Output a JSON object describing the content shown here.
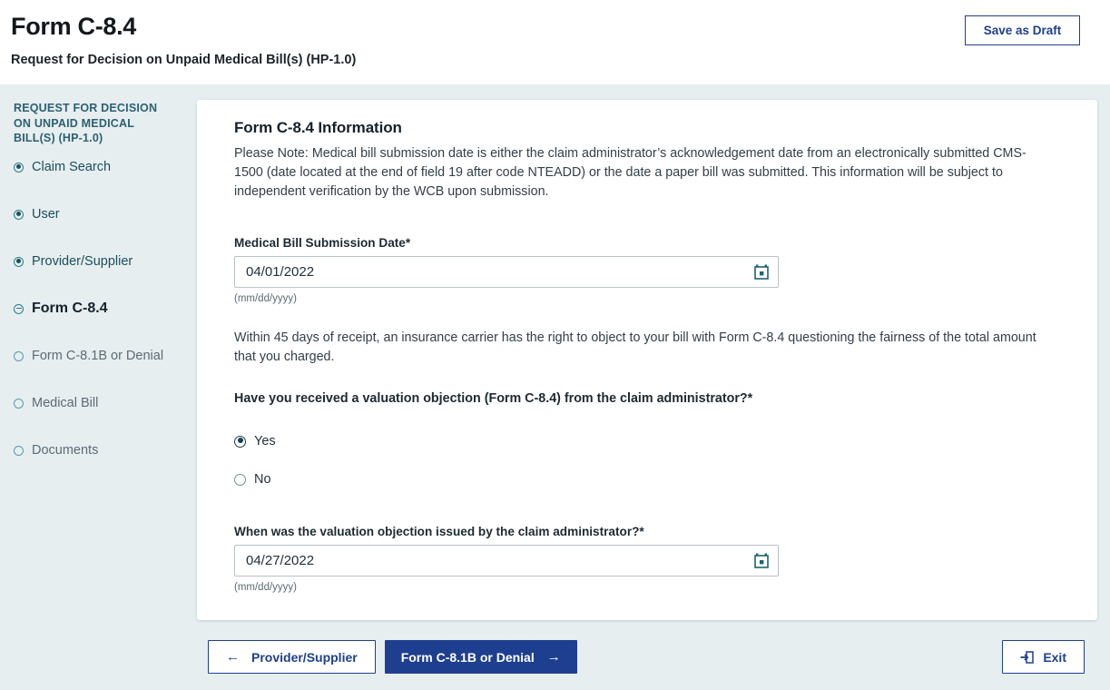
{
  "header": {
    "title": "Form C-8.4",
    "subtitle": "Request for Decision on Unpaid Medical Bill(s) (HP-1.0)",
    "save_draft_label": "Save as Draft"
  },
  "sidebar": {
    "heading": "REQUEST FOR DECISION ON UNPAID MEDICAL BILL(S) (HP-1.0)",
    "items": [
      {
        "label": "Claim Search",
        "state": "done"
      },
      {
        "label": "User",
        "state": "done"
      },
      {
        "label": "Provider/Supplier",
        "state": "done"
      },
      {
        "label": "Form C-8.4",
        "state": "current"
      },
      {
        "label": "Form C-8.1B or Denial",
        "state": "todo"
      },
      {
        "label": "Medical Bill",
        "state": "todo"
      },
      {
        "label": "Documents",
        "state": "todo"
      }
    ]
  },
  "main": {
    "card_title": "Form C-8.4 Information",
    "note": "Please Note: Medical bill submission date is either the claim administrator’s acknowledgement date from an electronically submitted CMS-1500 (date located at the end of field 19 after code NTEADD) or the date a paper bill was submitted. This information will be subject to independent verification by the WCB upon submission.",
    "submission_date": {
      "label": "Medical Bill Submission Date",
      "required_mark": "*",
      "value": "04/01/2022",
      "placeholder": "mm/dd/yyyy",
      "hint": "(mm/dd/yyyy)"
    },
    "paragraph": "Within 45 days of receipt, an insurance carrier has the right to object to your bill with Form C-8.4 questioning the fairness of the total amount that you charged.",
    "question": "Have you received a valuation objection (Form C-8.4) from the claim administrator?",
    "question_required_mark": "*",
    "options": [
      {
        "label": "Yes",
        "selected": true
      },
      {
        "label": "No",
        "selected": false
      }
    ],
    "objection_date": {
      "label": "When was the valuation objection issued by the claim administrator?",
      "required_mark": "*",
      "value": "04/27/2022",
      "placeholder": "mm/dd/yyyy",
      "hint": "(mm/dd/yyyy)"
    }
  },
  "footer": {
    "back_label": "Provider/Supplier",
    "back_arrow": "←",
    "next_label": "Form C-8.1B or Denial",
    "next_arrow": "→",
    "exit_label": "Exit"
  },
  "colors": {
    "navy": "#1e3f8f",
    "teal": "#2c7f8c",
    "page_bg": "#e6eef0"
  }
}
